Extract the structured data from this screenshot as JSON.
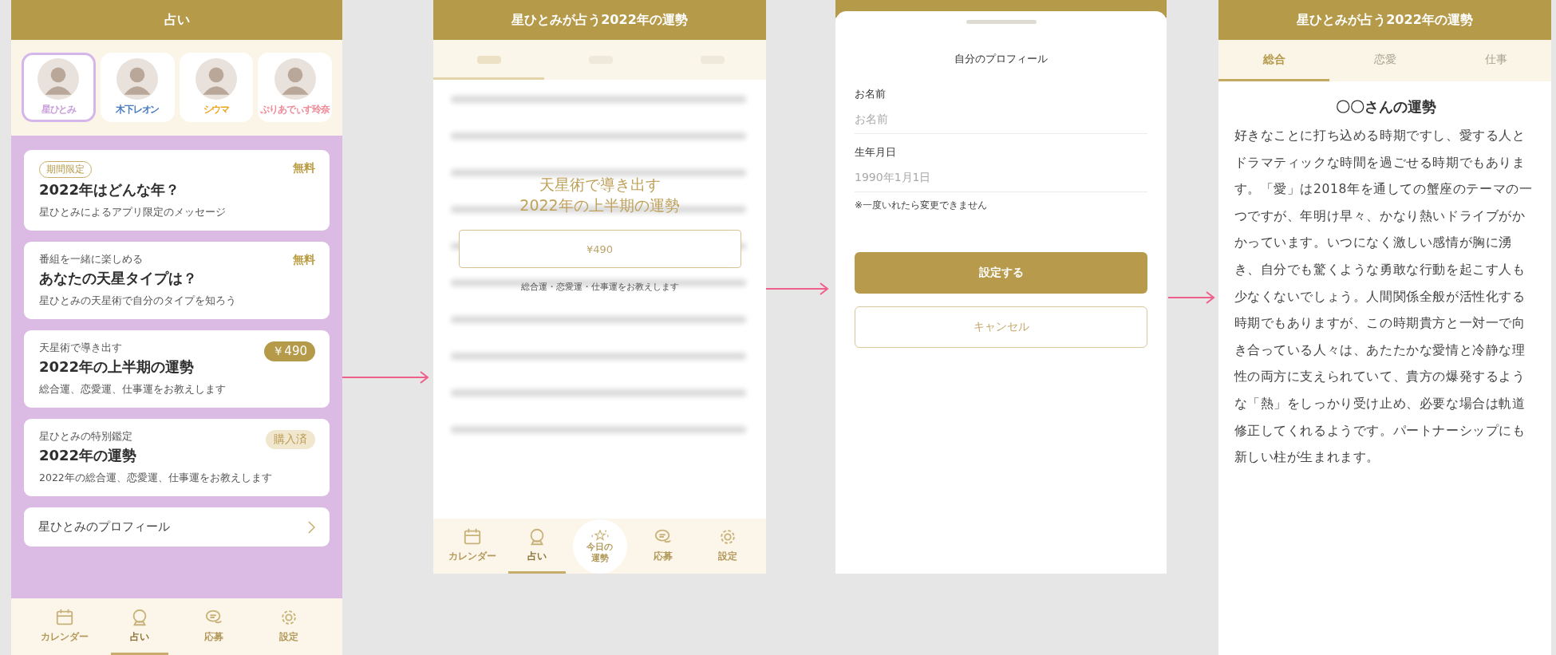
{
  "home": {
    "title": "占い",
    "fortune_tellers": [
      {
        "name": "星ひとみ",
        "color": "#c9a0dc",
        "selected": true
      },
      {
        "name": "木下レオン",
        "color": "#4a7cc0",
        "selected": false
      },
      {
        "name": "シウマ",
        "color": "#f0a41e",
        "selected": false
      },
      {
        "name": "ぷりあでぃす玲奈",
        "color": "#ee8a98",
        "selected": false
      }
    ],
    "menu_cards": [
      {
        "tag": "期間限定",
        "title": "2022年はどんな年？",
        "description": "星ひとみによるアプリ限定のメッセージ",
        "badge": "無料",
        "kind": "free"
      },
      {
        "eyebrow": "番組を一緒に楽しめる",
        "title": "あなたの天星タイプは？",
        "description": "星ひとみの天星術で自分のタイプを知ろう",
        "badge": "無料",
        "kind": "free"
      },
      {
        "eyebrow": "天星術で導き出す",
        "title": "2022年の上半期の運勢",
        "description": "総合運、恋愛運、仕事運をお教えします",
        "badge": "￥490",
        "kind": "price"
      },
      {
        "eyebrow": "星ひとみの特別鑑定",
        "title": "2022年の運勢",
        "description": "2022年の総合運、恋愛運、仕事運をお教えします",
        "badge": "購入済",
        "kind": "purchased"
      }
    ],
    "profile_link": "星ひとみのプロフィール",
    "tab_bar": [
      {
        "label": "カレンダー",
        "selected": false
      },
      {
        "label": "占い",
        "selected": true
      },
      {
        "label": "応募",
        "selected": false
      },
      {
        "label": "設定",
        "selected": false
      }
    ]
  },
  "locked_reading": {
    "title": "星ひとみが占う2022年の運勢",
    "offer_title": "天星術で導き出す",
    "offer_subtitle": "2022年の上半期の運勢",
    "buy_button": "¥490",
    "offer_note": "総合運・恋愛運・仕事運をお教えします",
    "tab_bar": [
      {
        "label": "カレンダー",
        "selected": false,
        "kind": "tab"
      },
      {
        "label": "占い",
        "selected": true,
        "kind": "tab"
      },
      {
        "label": "今日の運勢",
        "selected": false,
        "kind": "feature"
      },
      {
        "label": "応募",
        "selected": false,
        "kind": "tab"
      },
      {
        "label": "設定",
        "selected": false,
        "kind": "tab"
      }
    ]
  },
  "profile_sheet": {
    "title": "自分のプロフィール",
    "fields": [
      {
        "label": "お名前",
        "placeholder": "お名前"
      },
      {
        "label": "生年月日",
        "placeholder": "1990年1月1日",
        "note": "※一度いれたら変更できません"
      }
    ],
    "buttons": [
      {
        "label": "設定する",
        "kind": "primary"
      },
      {
        "label": "キャンセル",
        "kind": "secondary"
      }
    ]
  },
  "reading": {
    "title": "星ひとみが占う2022年の運勢",
    "tabs": [
      {
        "label": "総合",
        "selected": true
      },
      {
        "label": "恋愛",
        "selected": false
      },
      {
        "label": "仕事",
        "selected": false
      }
    ],
    "heading": "〇〇さんの運勢",
    "body": "好きなことに打ち込める時期ですし、愛する人とドラマティックな時間を過ごせる時期でもあります。「愛」は2018年を通しての蟹座のテーマの一つですが、年明け早々、かなり熱いドライブがかかっています。いつになく激しい感情が胸に湧き、自分でも驚くような勇敢な行動を起こす人も少なくないでしょう。人間関係全般が活性化する時期でもありますが、この時期貴方と一対一で向き合っている人々は、あたたかな愛情と冷静な理性の両方に支えられていて、貴方の爆発するような「熱」をしっかり受け止め、必要な場合は軌道修正してくれるようです。パートナーシップにも新しい柱が生まれます。"
  }
}
